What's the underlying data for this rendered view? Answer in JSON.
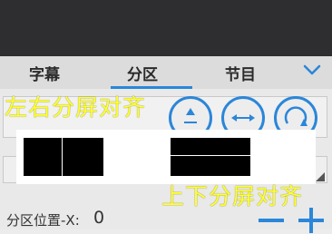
{
  "tabs": [
    {
      "label": "字幕"
    },
    {
      "label": "分区"
    },
    {
      "label": "节目"
    }
  ],
  "active_tab": "分区",
  "expand_icon": "chevron-down-icon",
  "controls": {
    "buttons": [
      "align-up-icon",
      "expand-horizontal-icon",
      "rotate-icon"
    ]
  },
  "modes": {
    "left_right": "左右分屏对齐",
    "top_bottom": "上下分屏对齐"
  },
  "position": {
    "label": "分区位置-X:",
    "value": "0"
  },
  "colors": {
    "accent": "#2b86d9",
    "caption": "#ffff2e"
  }
}
